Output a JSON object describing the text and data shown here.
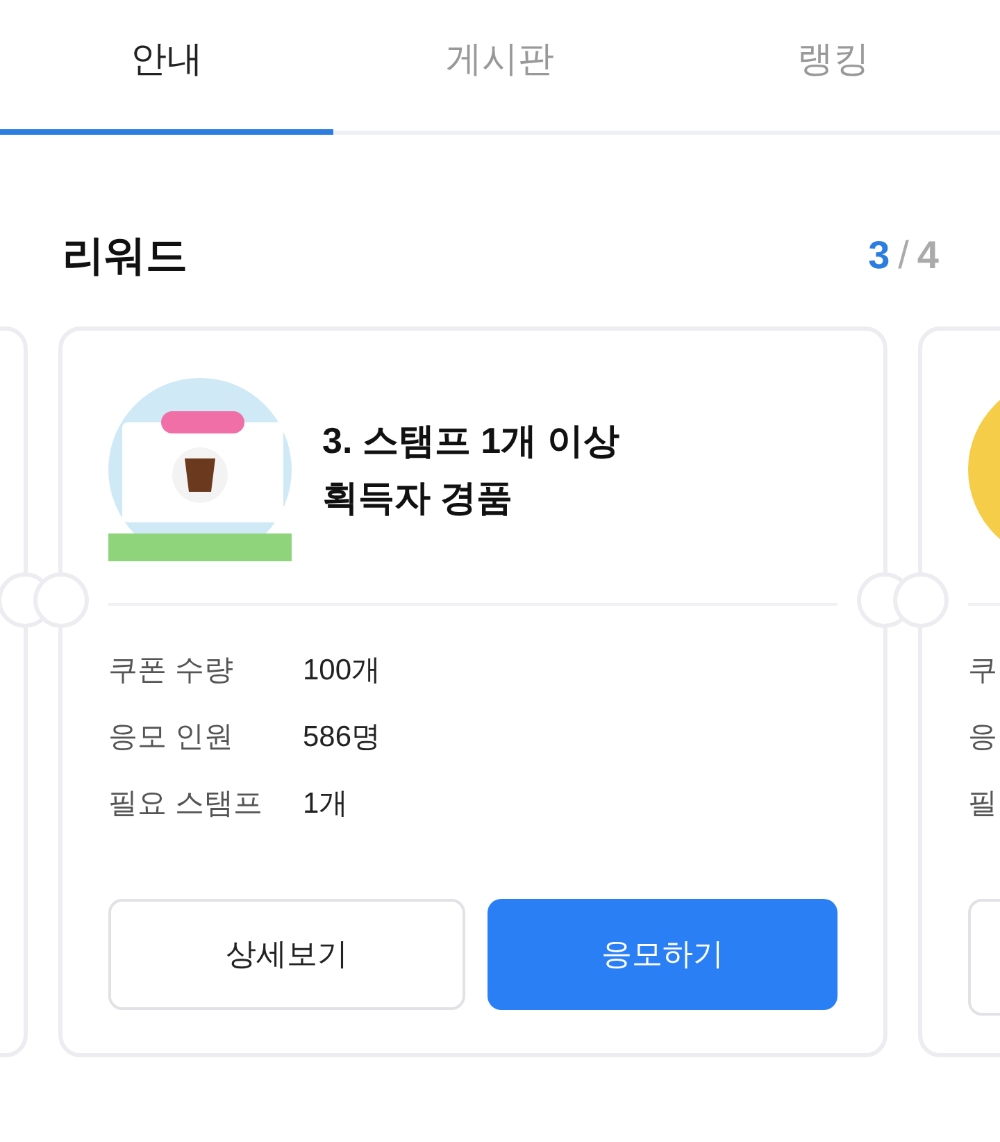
{
  "tabs": [
    {
      "label": "안내",
      "selected": true
    },
    {
      "label": "게시판",
      "selected": false
    },
    {
      "label": "랭킹",
      "selected": false
    }
  ],
  "section": {
    "title": "리워드",
    "pager": {
      "current": "3",
      "separator": "/",
      "total": "4"
    }
  },
  "card": {
    "title_lines": [
      "3. 스탬프 1개 이상",
      "획득자 경품"
    ],
    "details": [
      {
        "label": "쿠폰 수량",
        "value": "100개"
      },
      {
        "label": "응모 인원",
        "value": "586명"
      },
      {
        "label": "필요 스탬프",
        "value": "1개"
      }
    ],
    "buttons": [
      {
        "label": "상세보기",
        "kind": "secondary"
      },
      {
        "label": "응모하기",
        "kind": "primary"
      }
    ]
  },
  "next_card": {
    "labels": [
      "쿠",
      "응",
      "필"
    ]
  }
}
